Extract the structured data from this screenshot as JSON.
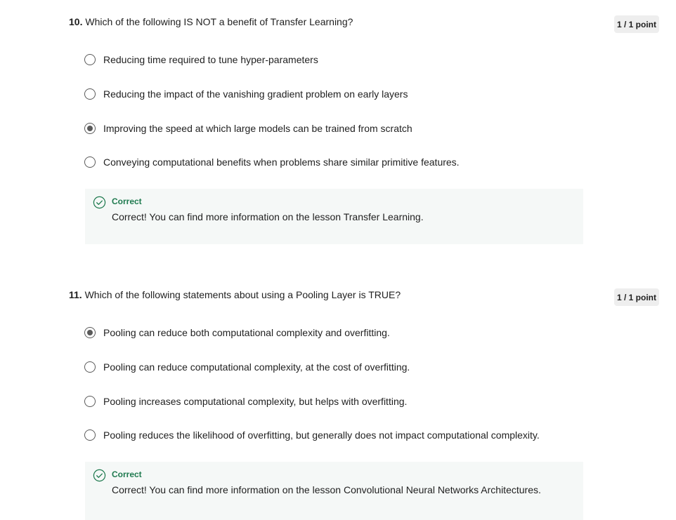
{
  "colors": {
    "correct_green": "#1f7a4f",
    "feedback_bg": "#f5f8f7",
    "badge_bg": "#eeeeee",
    "radio_gray": "#5a5a5a"
  },
  "questions": [
    {
      "number": "10.",
      "text": "Which of the following IS NOT a benefit of Transfer Learning?",
      "points": "1 / 1 point",
      "selected_index": 2,
      "options": [
        "Reducing time required to tune hyper-parameters",
        "Reducing the impact of the vanishing gradient problem on early layers",
        "Improving the speed at which large models can be trained from scratch",
        "Conveying computational benefits when problems share similar primitive features."
      ],
      "feedback": {
        "icon": "check-circle-icon",
        "title": "Correct",
        "text": "Correct! You can find more information on the lesson Transfer Learning."
      }
    },
    {
      "number": "11.",
      "text": "Which of the following statements about using a Pooling Layer is TRUE?",
      "points": "1 / 1 point",
      "selected_index": 0,
      "options": [
        "Pooling can reduce both computational complexity and overfitting.",
        "Pooling can reduce computational complexity, at the cost of overfitting.",
        "Pooling increases computational complexity, but helps with overfitting.",
        "Pooling reduces the likelihood of overfitting, but generally does not impact computational complexity."
      ],
      "feedback": {
        "icon": "check-circle-icon",
        "title": "Correct",
        "text": "Correct! You can find more information on the lesson Convolutional Neural Networks Architectures."
      }
    }
  ]
}
